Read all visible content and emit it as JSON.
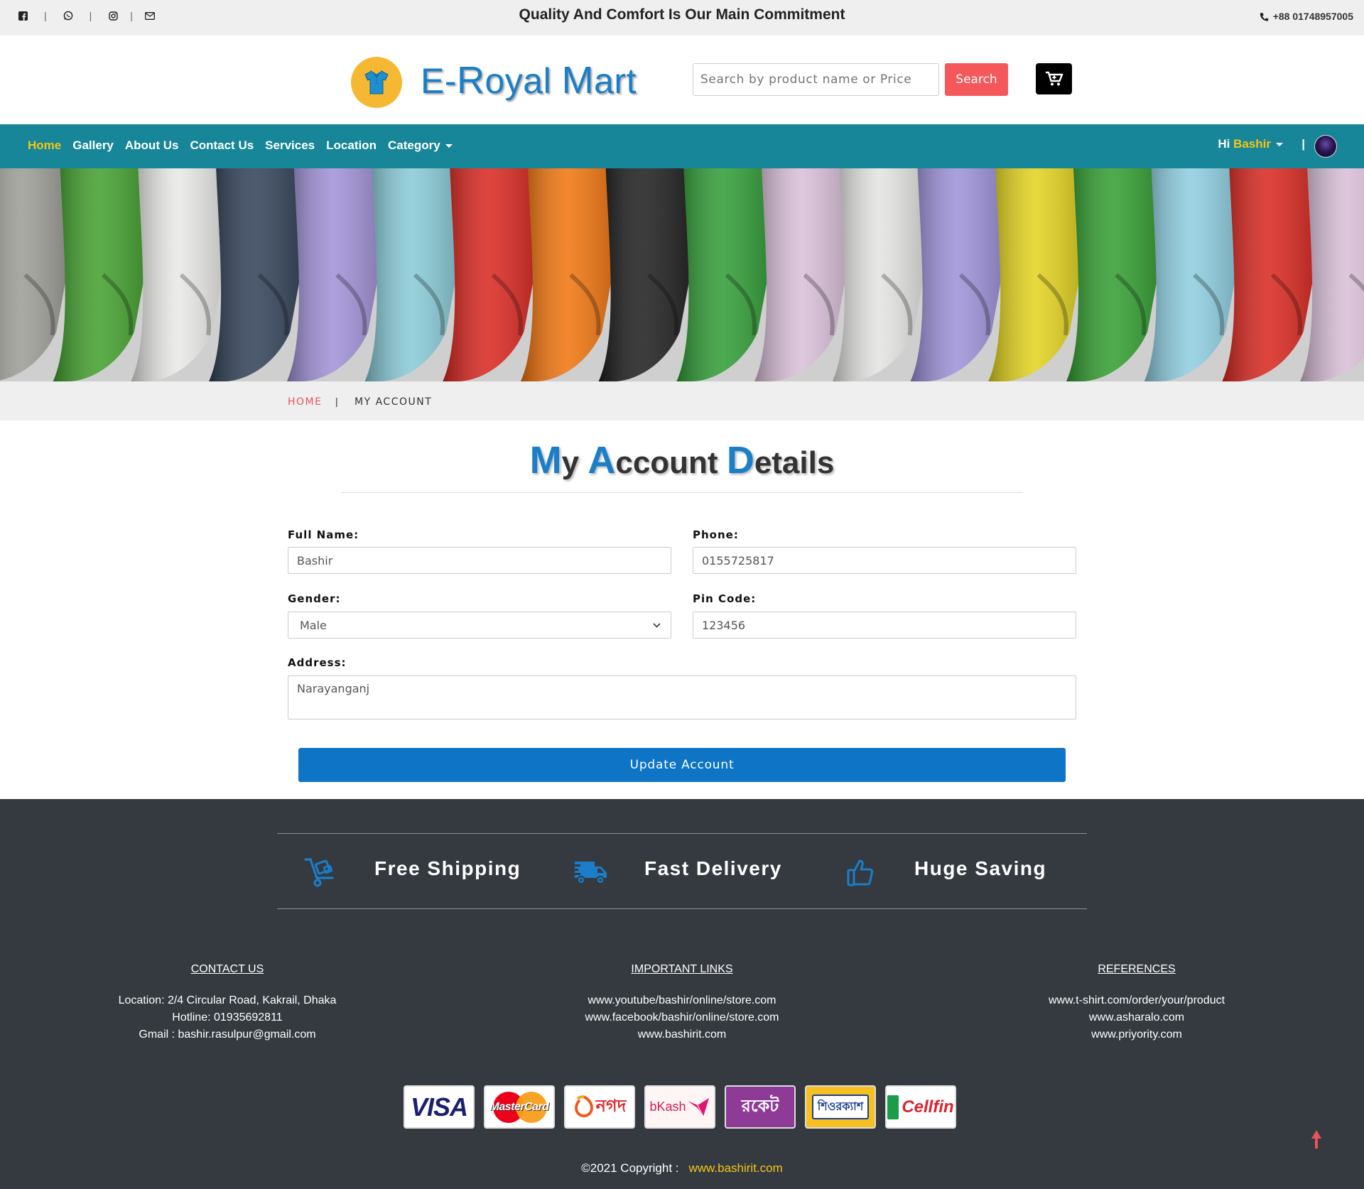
{
  "topbar": {
    "tagline": "Quality And Comfort Is Our Main Commitment",
    "phone": "+88 01748957005",
    "social_icons": [
      "facebook-icon",
      "whatsapp-icon",
      "instagram-icon",
      "envelope-icon"
    ]
  },
  "header": {
    "brand_prefix": "E-",
    "brand_r": "R",
    "brand_oyal": "oyal ",
    "brand_m": "M",
    "brand_art": "art",
    "search_placeholder": "Search by product name or Price",
    "search_label": "Search"
  },
  "nav": {
    "items": [
      {
        "label": "Home",
        "active": true
      },
      {
        "label": "Gallery"
      },
      {
        "label": "About Us"
      },
      {
        "label": "Contact Us"
      },
      {
        "label": "Services"
      },
      {
        "label": "Location"
      },
      {
        "label": "Category"
      }
    ],
    "greeting": "Hi",
    "user_name": "Bashir",
    "divider": "|"
  },
  "breadcrumb": {
    "home": "HOME",
    "separator": "|",
    "current": "MY ACCOUNT"
  },
  "page": {
    "title_m": "M",
    "title_y": "y ",
    "title_a": "A",
    "title_ccount": "ccount ",
    "title_d": "D",
    "title_etails": "etails"
  },
  "form": {
    "full_name_label": "Full Name:",
    "full_name_value": "Bashir",
    "phone_label": "Phone:",
    "phone_value": "0155725817",
    "gender_label": "Gender:",
    "gender_value": "Male",
    "pin_label": "Pin Code:",
    "pin_value": "123456",
    "address_label": "Address:",
    "address_value": "Narayanganj",
    "submit_label": "Update Account"
  },
  "features": [
    {
      "label": "Free Shipping",
      "icon": "cart-dolly-icon"
    },
    {
      "label": "Fast Delivery",
      "icon": "truck-icon"
    },
    {
      "label": "Huge Saving",
      "icon": "thumbs-up-icon"
    }
  ],
  "footer": {
    "contact": {
      "heading": "CONTACT US",
      "lines": [
        "Location: 2/4 Circular Road, Kakrail, Dhaka",
        "Hotline: 01935692811",
        "Gmail : bashir.rasulpur@gmail.com"
      ]
    },
    "links": {
      "heading": "IMPORTANT LINKS",
      "lines": [
        "www.youtube/bashir/online/store.com",
        "www.facebook/bashir/online/store.com",
        "www.bashirit.com"
      ]
    },
    "references": {
      "heading": "REFERENCES",
      "lines": [
        "www.t-shirt.com/order/your/product",
        "www.asharalo.com",
        "www.priyority.com"
      ]
    },
    "payments": [
      "VISA",
      "MasterCard",
      "নগদ",
      "bKash",
      "রকেট",
      "শিওরক্যাশ",
      "Cellfin"
    ],
    "copyright_text": "©2021 Copyright :",
    "copyright_link": "www.bashirit.com"
  },
  "colors": {
    "nav_bg": "#168698",
    "accent_yellow": "#f5c518",
    "search_red": "#f4585b",
    "primary_blue": "#0d74c6",
    "footer_bg": "#343a40"
  }
}
